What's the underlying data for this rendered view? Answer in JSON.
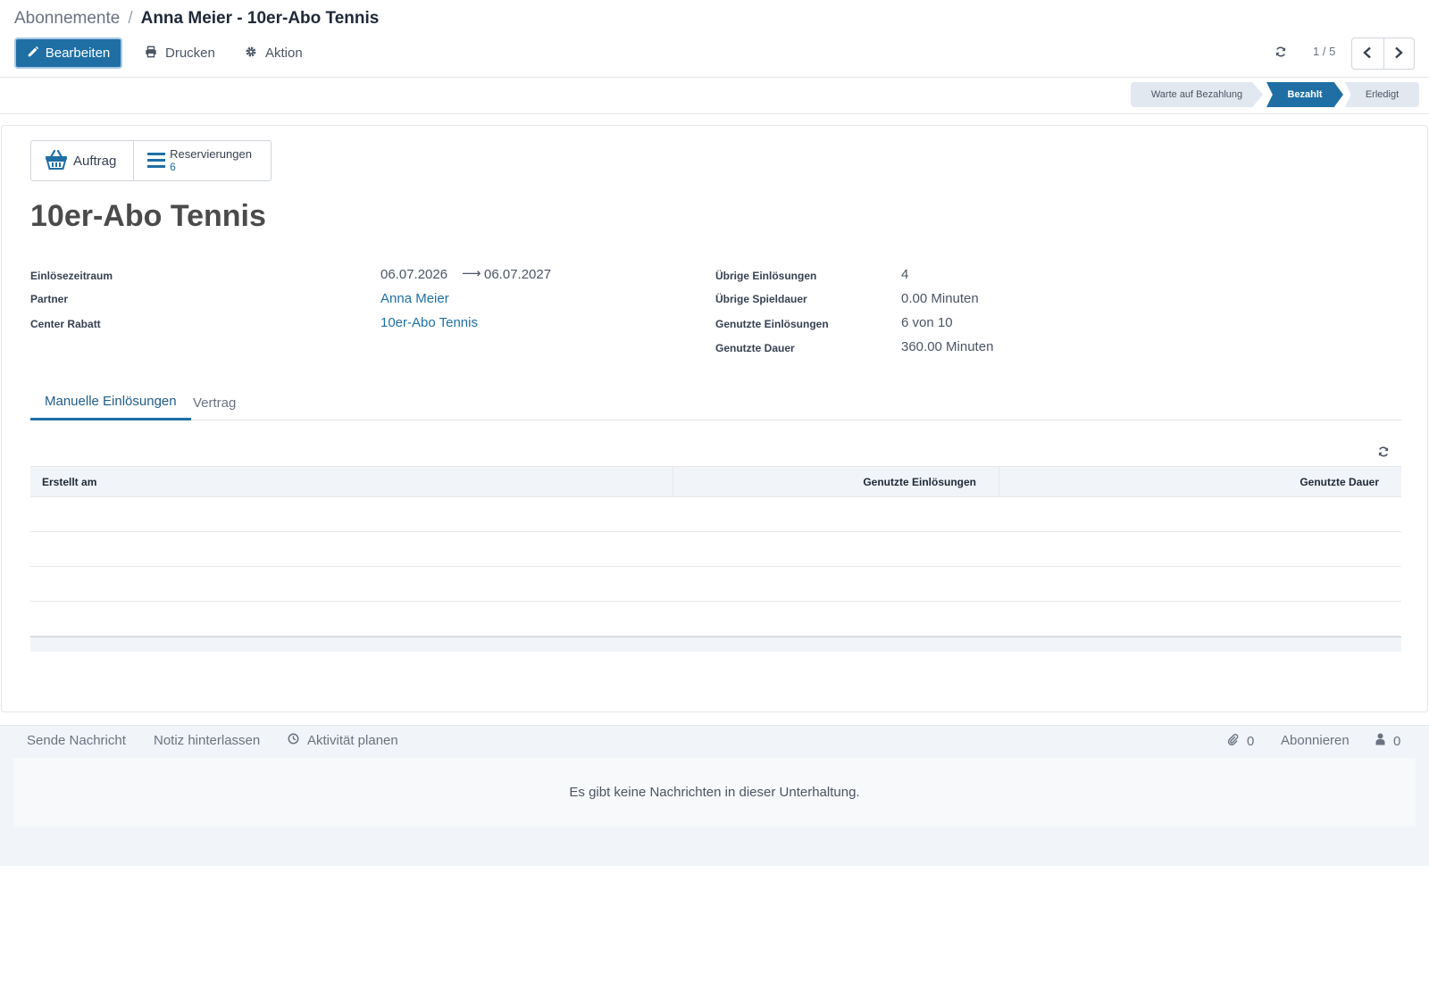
{
  "breadcrumb": {
    "parent": "Abonnemente",
    "separator": "/",
    "current": "Anna Meier - 10er-Abo Tennis"
  },
  "toolbar": {
    "edit_label": "Bearbeiten",
    "print_label": "Drucken",
    "action_label": "Aktion"
  },
  "pager": {
    "value": "1 / 5"
  },
  "statusbar": {
    "stages": [
      "Warte auf Bezahlung",
      "Bezahlt",
      "Erledigt"
    ],
    "active": "Bezahlt"
  },
  "smart_buttons": {
    "order_label": "Auftrag",
    "reservations_label": "Reservierungen",
    "reservations_count": "6"
  },
  "record": {
    "title": "10er-Abo Tennis"
  },
  "fields_left": [
    {
      "label": "Einlösezeitraum",
      "from": "06.07.2026",
      "arrow": "⟶",
      "to": "06.07.2027"
    },
    {
      "label": "Partner",
      "value": "Anna Meier"
    },
    {
      "label": "Center Rabatt",
      "value": "10er-Abo Tennis"
    }
  ],
  "fields_right": [
    {
      "label": "Übrige Einlösungen",
      "value": "4"
    },
    {
      "label": "Übrige Spieldauer",
      "value": "0.00 Minuten"
    },
    {
      "label": "Genutzte Einlösungen",
      "value": "6 von 10"
    },
    {
      "label": "Genutzte Dauer",
      "value": "360.00 Minuten"
    }
  ],
  "tabs": [
    {
      "label": "Manuelle Einlösungen"
    },
    {
      "label": "Vertrag"
    }
  ],
  "table": {
    "headers": [
      "Erstellt am",
      "Genutzte Einlösungen",
      "Genutzte Dauer"
    ]
  },
  "chatter": {
    "send_message": "Sende Nachricht",
    "log_note": "Notiz hinterlassen",
    "schedule_activity": "Aktivität planen",
    "attachments_count": "0",
    "follow": "Abonnieren",
    "followers_count": "0",
    "empty_text": "Es gibt keine Nachrichten in dieser Unterhaltung."
  },
  "colors": {
    "primary": "#1f6fa5",
    "header_bg": "#f1f4f8",
    "stage_inactive": "#e2e8f0"
  }
}
